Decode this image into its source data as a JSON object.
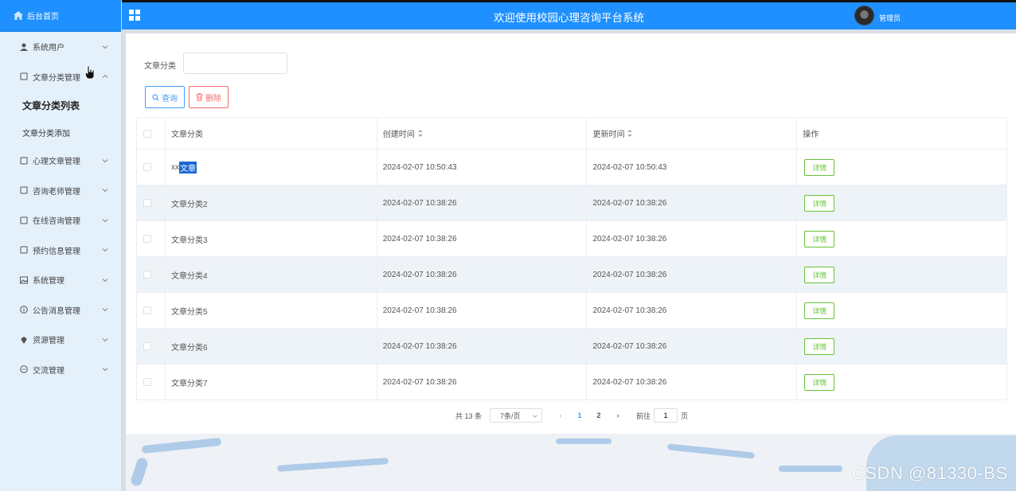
{
  "sidebar": {
    "home_label": "后台首页",
    "menu": [
      {
        "label": "系统用户",
        "icon": "user-icon"
      },
      {
        "label": "文章分类管理",
        "icon": "document-icon",
        "expanded": true
      },
      {
        "label": "心理文章管理",
        "icon": "document-icon"
      },
      {
        "label": "咨询老师管理",
        "icon": "document-icon"
      },
      {
        "label": "在线咨询管理",
        "icon": "document-icon"
      },
      {
        "label": "预约信息管理",
        "icon": "document-icon"
      },
      {
        "label": "系统管理",
        "icon": "picture-icon"
      },
      {
        "label": "公告消息管理",
        "icon": "info-circle-icon"
      },
      {
        "label": "资源管理",
        "icon": "location-pin-icon"
      },
      {
        "label": "交流管理",
        "icon": "chat-bubble-icon"
      }
    ],
    "submenu": [
      {
        "label": "文章分类列表",
        "active": true
      },
      {
        "label": "文章分类添加",
        "active": false
      }
    ]
  },
  "header": {
    "title": "欢迎使用校园心理咨询平台系统",
    "user_name": "管理员"
  },
  "search": {
    "label": "文章分类",
    "value": "",
    "query_button": "查询",
    "delete_button": "删除"
  },
  "table": {
    "columns": [
      "文章分类",
      "创建时间",
      "更新时间",
      "操作"
    ],
    "action_label": "详情",
    "rows": [
      {
        "category_prefix": "xx",
        "category_highlight": "文章",
        "created": "2024-02-07 10:50:43",
        "updated": "2024-02-07 10:50:43"
      },
      {
        "category": "文章分类2",
        "created": "2024-02-07 10:38:26",
        "updated": "2024-02-07 10:38:26"
      },
      {
        "category": "文章分类3",
        "created": "2024-02-07 10:38:26",
        "updated": "2024-02-07 10:38:26"
      },
      {
        "category": "文章分类4",
        "created": "2024-02-07 10:38:26",
        "updated": "2024-02-07 10:38:26"
      },
      {
        "category": "文章分类5",
        "created": "2024-02-07 10:38:26",
        "updated": "2024-02-07 10:38:26"
      },
      {
        "category": "文章分类6",
        "created": "2024-02-07 10:38:26",
        "updated": "2024-02-07 10:38:26"
      },
      {
        "category": "文章分类7",
        "created": "2024-02-07 10:38:26",
        "updated": "2024-02-07 10:38:26"
      }
    ]
  },
  "pagination": {
    "total_text": "共 13 条",
    "page_size": "7条/页",
    "pages": [
      "1",
      "2"
    ],
    "current_page": "1",
    "goto_label": "前往",
    "goto_value": "1",
    "page_unit": "页"
  },
  "watermark": "CSDN @81330-BS",
  "colors": {
    "primary": "#1e90ff",
    "sidebar_bg": "#e4f1fb",
    "query": "#409eff",
    "delete": "#f56c6c",
    "detail": "#67c23a"
  }
}
